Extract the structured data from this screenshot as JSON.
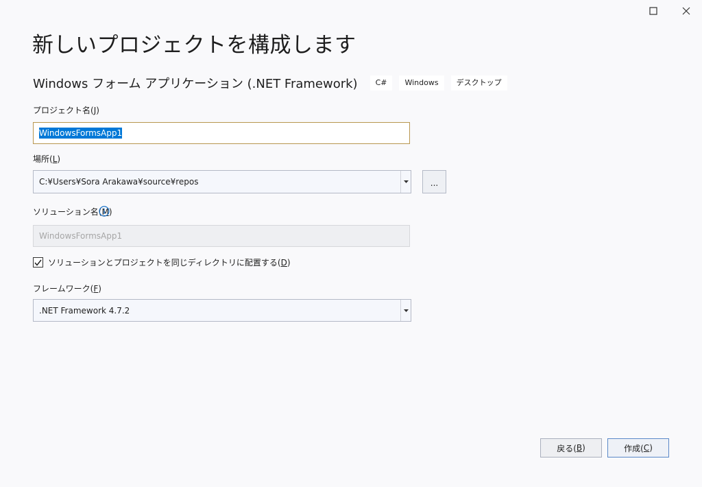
{
  "window": {
    "maximize_icon": "maximize-icon",
    "close_icon": "close-icon"
  },
  "page": {
    "title": "新しいプロジェクトを構成します"
  },
  "template": {
    "name": "Windows フォーム アプリケーション (.NET Framework)",
    "tags": [
      "C#",
      "Windows",
      "デスクトップ"
    ]
  },
  "project_name": {
    "label_prefix": "プロジェクト名(",
    "label_key": "J",
    "label_suffix": ")",
    "value": "WindowsFormsApp1"
  },
  "location": {
    "label_prefix": "場所(",
    "label_key": "L",
    "label_suffix": ")",
    "value": "C:¥Users¥Sora Arakawa¥source¥repos",
    "browse_label": "..."
  },
  "solution_name": {
    "label_prefix": "ソリューション名(",
    "label_key": "M",
    "label_suffix": ")",
    "placeholder": "WindowsFormsApp1",
    "info_icon": "info-icon"
  },
  "same_directory": {
    "checked": true,
    "label_prefix": "ソリューションとプロジェクトを同じディレクトリに配置する(",
    "label_key": "D",
    "label_suffix": ")"
  },
  "framework": {
    "label_prefix": "フレームワーク(",
    "label_key": "F",
    "label_suffix": ")",
    "value": ".NET Framework 4.7.2"
  },
  "buttons": {
    "back_prefix": "戻る(",
    "back_key": "B",
    "back_suffix": ")",
    "create_prefix": "作成(",
    "create_key": "C",
    "create_suffix": ")"
  },
  "colors": {
    "background": "#f9f9fb",
    "selection": "#0078d7",
    "focus_border": "#b8964e",
    "info_blue": "#1a73c9"
  }
}
